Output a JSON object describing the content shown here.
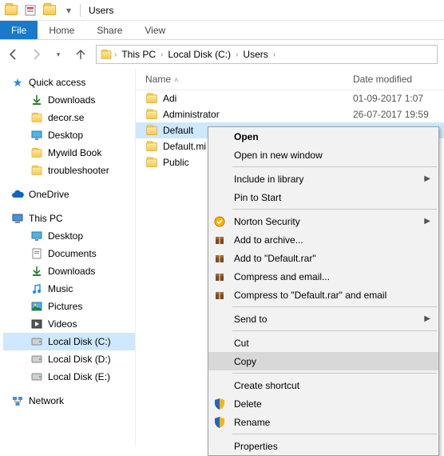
{
  "titlebar": {
    "title": "Users"
  },
  "ribbon": {
    "file": "File",
    "home": "Home",
    "share": "Share",
    "view": "View"
  },
  "breadcrumbs": {
    "pc": "This PC",
    "drive": "Local Disk (C:)",
    "folder": "Users"
  },
  "tree": {
    "quick": "Quick access",
    "qa": {
      "downloads": "Downloads",
      "decor": "decor.se",
      "desktop": "Desktop",
      "mywild": "Mywild Book",
      "trouble": "troubleshooter"
    },
    "onedrive": "OneDrive",
    "thispc": "This PC",
    "pc": {
      "desktop": "Desktop",
      "documents": "Documents",
      "downloads": "Downloads",
      "music": "Music",
      "pictures": "Pictures",
      "videos": "Videos",
      "diskc": "Local Disk (C:)",
      "diskd": "Local Disk (D:)",
      "diske": "Local Disk (E:)"
    },
    "network": "Network"
  },
  "list": {
    "cols": {
      "name": "Name",
      "date": "Date modified"
    },
    "rows": {
      "adi": {
        "name": "Adi",
        "date": "01-09-2017 1:07"
      },
      "admin": {
        "name": "Administrator",
        "date": "26-07-2017 19:59"
      },
      "default": {
        "name": "Default",
        "date": ""
      },
      "defaultmi": {
        "name": "Default.mi",
        "date": ""
      },
      "public": {
        "name": "Public",
        "date": ""
      }
    }
  },
  "ctx": {
    "open": "Open",
    "open_new": "Open in new window",
    "include": "Include in library",
    "pin": "Pin to Start",
    "norton": "Norton Security",
    "addarchive": "Add to archive...",
    "addrar": "Add to \"Default.rar\"",
    "compress": "Compress and email...",
    "compressto": "Compress to \"Default.rar\" and email",
    "sendto": "Send to",
    "cut": "Cut",
    "copy": "Copy",
    "shortcut": "Create shortcut",
    "delete": "Delete",
    "rename": "Rename",
    "properties": "Properties"
  }
}
